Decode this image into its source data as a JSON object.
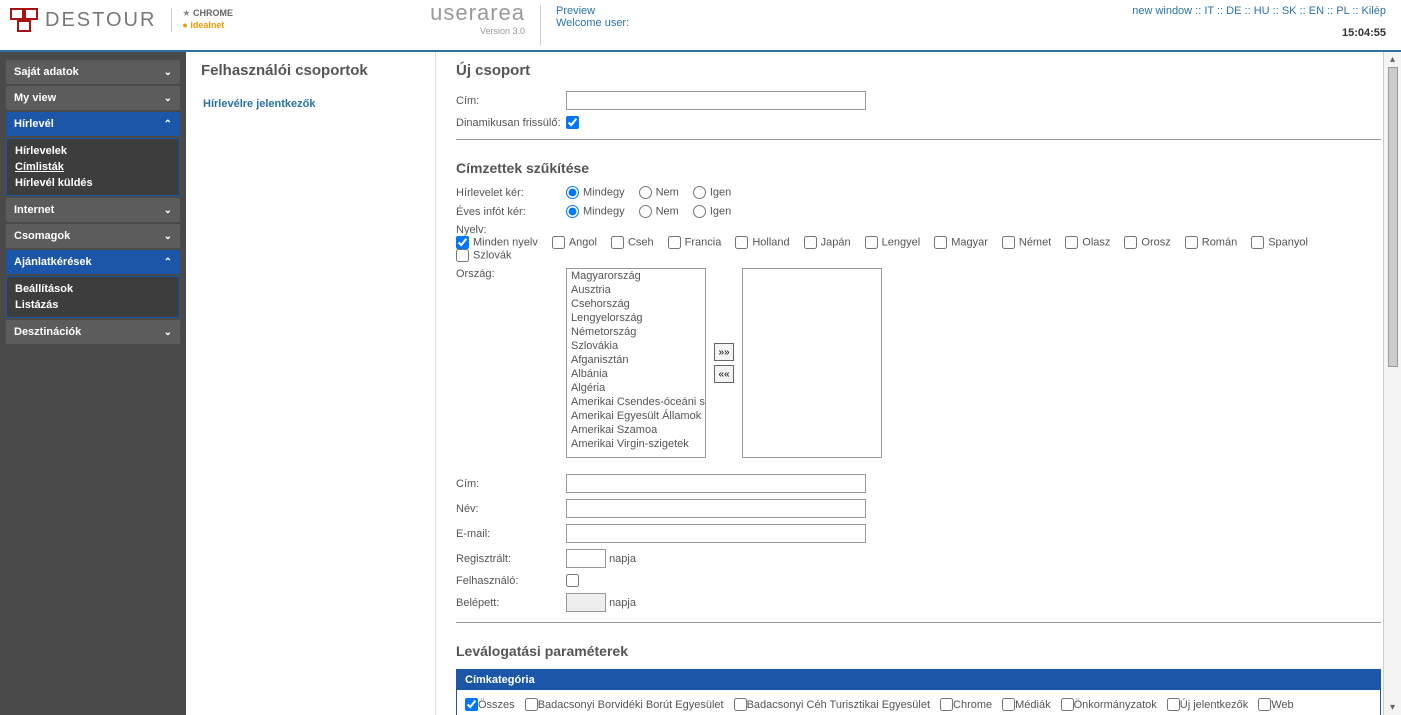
{
  "header": {
    "logo_text": "DESTOUR",
    "sublogo1": "CHROME",
    "sublogo2": "idealnet",
    "userarea": "userarea",
    "version": "Version 3.0",
    "preview": "Preview",
    "welcome": "Welcome user:"
  },
  "toplinks": {
    "new_window": "new window",
    "langs": [
      "IT",
      "DE",
      "HU",
      "SK",
      "EN",
      "PL"
    ],
    "logout": "Kilép",
    "time": "15:04:55"
  },
  "sidebar": {
    "sajat_adatok": "Saját adatok",
    "my_view": "My view",
    "hirlevel": "Hírlevél",
    "hirlevel_items": {
      "hirlevelek": "Hírlevelek",
      "cimlistak": "Címlisták",
      "hirlevel_kuldes": "Hírlevél küldés"
    },
    "internet": "Internet",
    "csomagok": "Csomagok",
    "ajanlatkeresek": "Ajánlatkérések",
    "ajanlat_items": {
      "beallitasok": "Beállítások",
      "listazas": "Listázás"
    },
    "desztinaciok": "Desztinációk"
  },
  "list_panel": {
    "title": "Felhasználói csoportok",
    "item1": "Hírlevélre jelentkezők"
  },
  "content": {
    "title": "Új csoport",
    "cim_label": "Cím:",
    "dinamikus_label": "Dinamikusan frissülő:",
    "szukites_title": "Címzettek szűkítése",
    "hirlevelet_label": "Hírlevelet kér:",
    "evesinfo_label": "Éves infót kér:",
    "opt_mindegy": "Mindegy",
    "opt_nem": "Nem",
    "opt_igen": "Igen",
    "nyelv_label": "Nyelv:",
    "langs": [
      "Minden nyelv",
      "Angol",
      "Cseh",
      "Francia",
      "Holland",
      "Japán",
      "Lengyel",
      "Magyar",
      "Német",
      "Olasz",
      "Orosz",
      "Román",
      "Spanyol",
      "Szlovák"
    ],
    "orszag_label": "Ország:",
    "countries": [
      "Magyarország",
      "Ausztria",
      "Csehország",
      "Lengyelország",
      "Németország",
      "Szlovákia",
      "Afganisztán",
      "Albánia",
      "Algéria",
      "Amerikai Csendes-óceáni s",
      "Amerikai Egyesült Államok",
      "Amerikai Szamoa",
      "Amerikai Virgin-szigetek"
    ],
    "move_right": "»»",
    "move_left": "««",
    "cim2_label": "Cím:",
    "nev_label": "Név:",
    "email_label": "E-mail:",
    "regisztralt_label": "Regisztrált:",
    "napja": "napja",
    "felhasznalo_label": "Felhasználó:",
    "belepett_label": "Belépett:",
    "levalogatas_title": "Leválogatási paraméterek",
    "cimkategoria": "Címkategória",
    "cats": [
      "Összes",
      "Badacsonyi Borvidéki Borút Egyesület",
      "Badacsonyi Céh Turisztikai Egyesület",
      "Chrome",
      "Médiák",
      "Önkormányzatok",
      "Új jelentkezők",
      "Web"
    ]
  }
}
